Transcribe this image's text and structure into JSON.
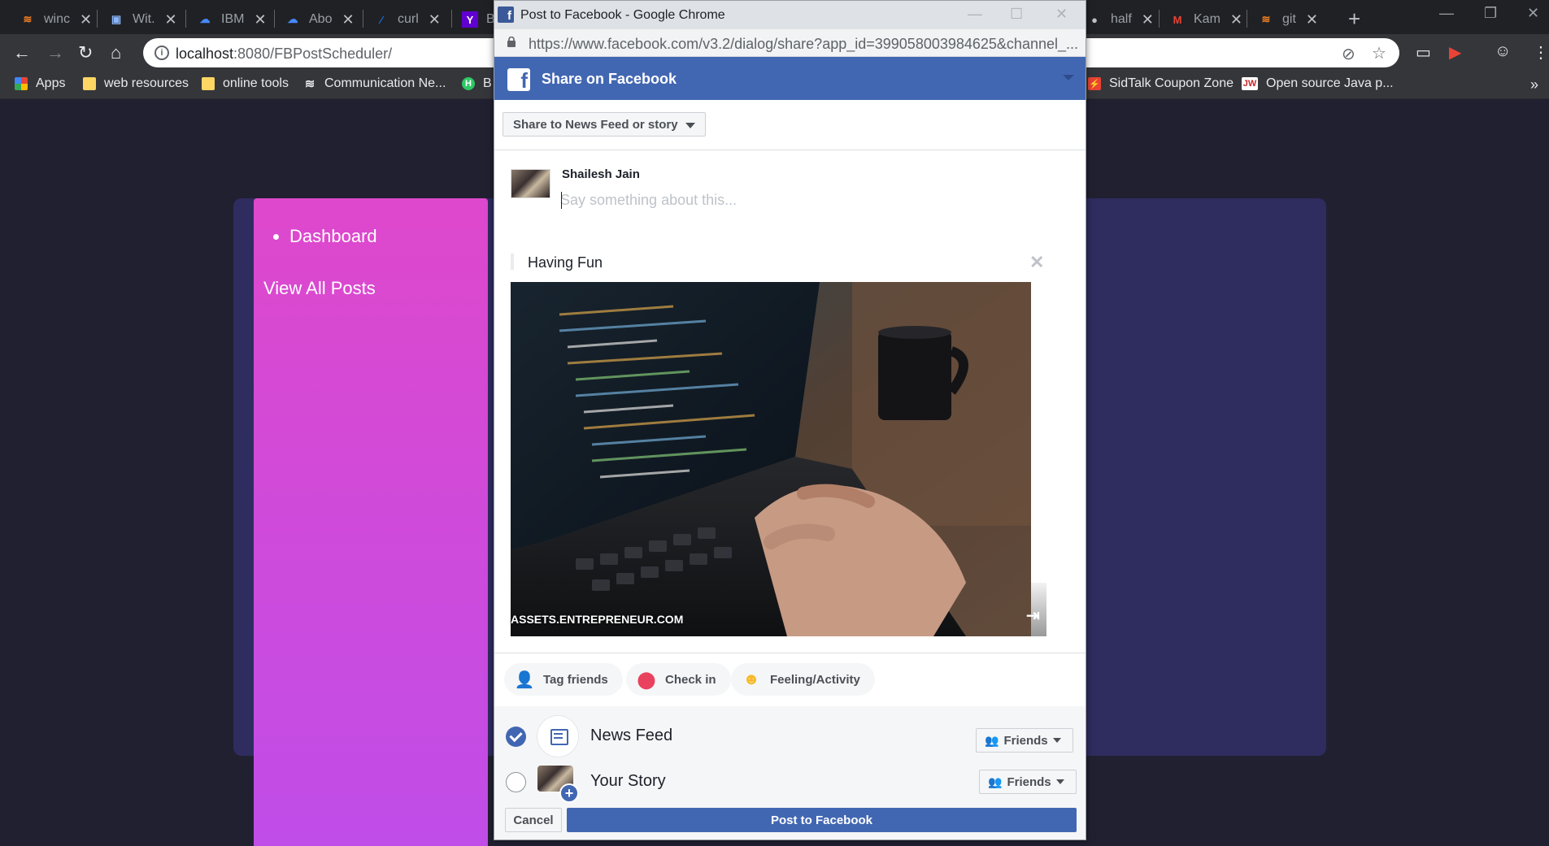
{
  "browser": {
    "tabs": [
      {
        "label": "winc",
        "icon": "stackoverflow-icon",
        "color": "#f48024"
      },
      {
        "label": "Wit.",
        "icon": "robot-icon",
        "color": "#8ab4f8"
      },
      {
        "label": "IBM",
        "icon": "ibm-cloud-icon",
        "color": "#4589ff"
      },
      {
        "label": "Abo",
        "icon": "ibm-cloud-icon",
        "color": "#4589ff"
      },
      {
        "label": "curl",
        "icon": "curl-icon",
        "color": "#1a73e8"
      },
      {
        "label": "B",
        "icon": "yahoo-icon",
        "color": "#6001d2"
      },
      {
        "label": "half",
        "icon": "github-icon",
        "color": "#bdc1c6"
      },
      {
        "label": "Kam",
        "icon": "gmail-icon",
        "color": "#ea4335"
      },
      {
        "label": "git",
        "icon": "stackoverflow-icon",
        "color": "#f48024"
      }
    ],
    "address_host": "localhost",
    "address_path": ":8080/FBPostScheduler/",
    "bookmarks": [
      {
        "label": "Apps",
        "icon": "apps-grid-icon"
      },
      {
        "label": "web resources",
        "icon": "folder-icon"
      },
      {
        "label": "online tools",
        "icon": "folder-icon"
      },
      {
        "label": "Communication Ne...",
        "icon": "wave-icon"
      },
      {
        "label": "B",
        "icon": "hackerrank-icon"
      },
      {
        "label": "SidTalk Coupon Zone",
        "icon": "sidtalk-icon"
      },
      {
        "label": "Open source Java p...",
        "icon": "jw-icon"
      }
    ]
  },
  "sidebar": {
    "items": [
      {
        "label": "Dashboard"
      },
      {
        "label": "View All Posts"
      }
    ]
  },
  "popup": {
    "window_title": "Post to Facebook - Google Chrome",
    "url": "https://www.facebook.com/v3.2/dialog/share?app_id=399058003984625&channel_...",
    "header_title": "Share on Facebook",
    "share_target": "Share to News Feed or story",
    "user_name": "Shailesh Jain",
    "composer_placeholder": "Say something about this...",
    "attachment_title": "Having Fun",
    "attachment_source": "ASSETS.ENTREPRENEUR.COM",
    "actions": {
      "tag_friends": "Tag friends",
      "check_in": "Check in",
      "feeling": "Feeling/Activity"
    },
    "audience": {
      "news_feed_label": "News Feed",
      "news_feed_checked": true,
      "news_feed_privacy": "Friends",
      "story_label": "Your Story",
      "story_checked": false,
      "story_privacy": "Friends"
    },
    "cancel_label": "Cancel",
    "post_label": "Post to Facebook"
  },
  "colors": {
    "facebook_blue": "#4267b2",
    "page_bg": "#212031",
    "panel_bg": "#2f2c5f",
    "sidebar_top": "#de48cc",
    "sidebar_bottom": "#bf4de9"
  }
}
